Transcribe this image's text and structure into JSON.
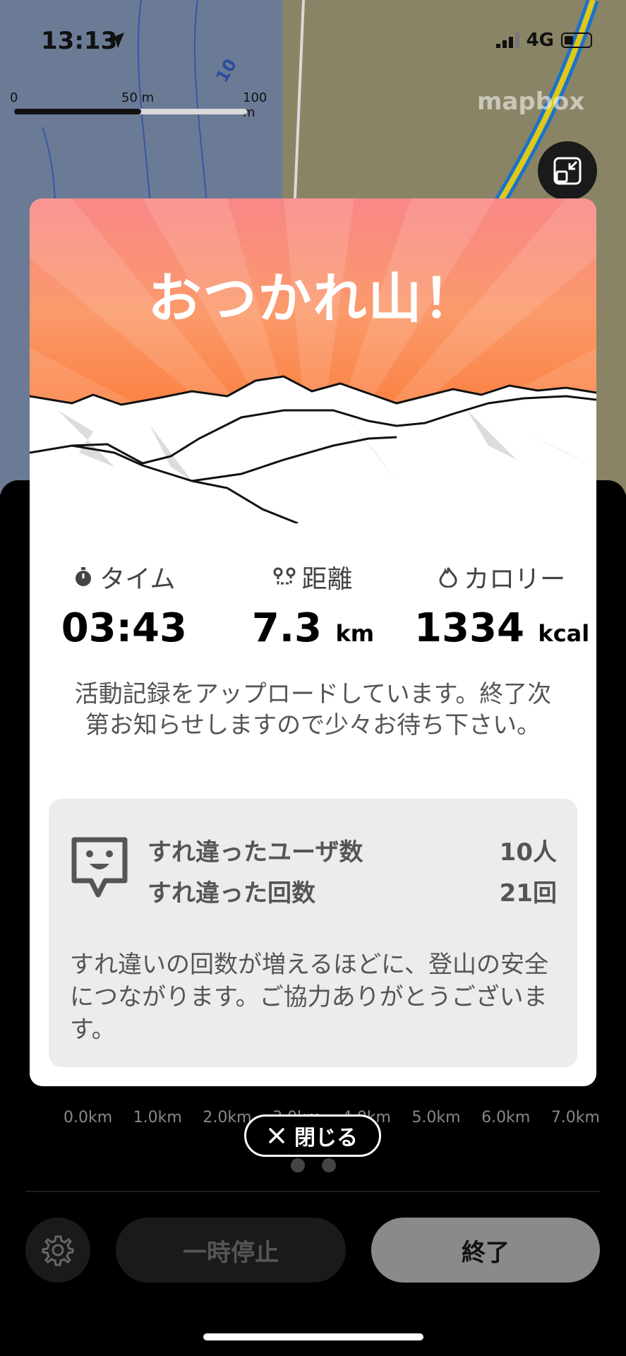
{
  "status": {
    "time": "13:13",
    "network": "4G"
  },
  "map": {
    "scale_labels": [
      "0",
      "50 m",
      "100 m"
    ],
    "contour_label": "10",
    "logo": "mapbox"
  },
  "modal": {
    "title": "おつかれ山！",
    "stats": [
      {
        "icon": "stopwatch-icon",
        "label": "タイム",
        "value": "03:43",
        "unit": ""
      },
      {
        "icon": "route-icon",
        "label": "距離",
        "value": "7.3",
        "unit": "km"
      },
      {
        "icon": "flame-icon",
        "label": "カロリー",
        "value": "1334",
        "unit": "kcal"
      }
    ],
    "upload_message": "活動記録をアップロードしています。終了次第お知らせしますので少々お待ち下さい。",
    "pass": {
      "users_label": "すれ違ったユーザ数",
      "users_value": "10人",
      "count_label": "すれ違った回数",
      "count_value": "21回",
      "note": "すれ違いの回数が増えるほどに、登山の安全につながります。ご協力ありがとうございます。"
    }
  },
  "elevation_axis": [
    "0.0km",
    "1.0km",
    "2.0km",
    "3.0km",
    "4.0km",
    "5.0km",
    "6.0km",
    "7.0km"
  ],
  "close_label": "閉じる",
  "controls": {
    "pause_label": "一時停止",
    "end_label": "終了"
  },
  "colors": {
    "hero_top": "#f98787",
    "hero_bottom": "#fb6d2a",
    "end_button": "#8a8a8a"
  }
}
